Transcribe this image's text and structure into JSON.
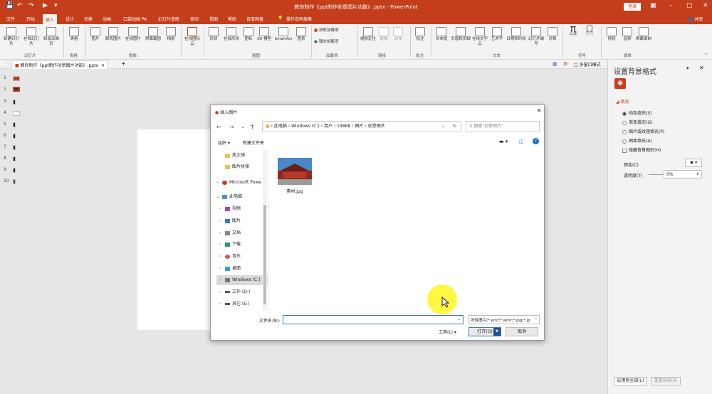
{
  "titlebar": {
    "title": "教你制作《ppt制作创意图片功能》.pptx - PowerPoint",
    "login": "登录",
    "share": "共享",
    "colors": {
      "brand": "#c43e1c"
    }
  },
  "quick_access": {
    "save_icon": "save-icon",
    "undo_icon": "undo-icon",
    "redo_icon": "redo-icon",
    "start_icon": "start-slideshow-icon",
    "more_icon": "more-icon"
  },
  "tabs": [
    "文件",
    "开始",
    "插入",
    "设计",
    "切换",
    "动画",
    "口袋动画 PA",
    "幻灯片放映",
    "审阅",
    "视图",
    "帮助",
    "百度网盘"
  ],
  "active_tab": "插入",
  "tell_me": "操作说明搜索",
  "ribbon": {
    "new_slide": "新建幻灯片",
    "online_slide": "在线幻灯片",
    "new_anim_page": "新加动画页",
    "group_slides": "幻灯片",
    "table": "表格",
    "group_table": "表格",
    "picture": "图片",
    "online_picture": "联机图片",
    "online_pic2": "在线图片",
    "screenshot": "屏幕截图",
    "album": "相册",
    "group_images": "图像",
    "online_icons": "在线图标云",
    "shapes": "形状",
    "online_shapes": "在线形状",
    "icons": "图标",
    "model3d": "3D 模型",
    "smartart": "SmartArt",
    "chart": "图表",
    "group_illus": "插图",
    "get_addins": "获取加载项",
    "my_addins": "我的加载项",
    "group_addins": "加载项",
    "zoom": "缩放定位",
    "link": "链接",
    "action": "动作",
    "group_links": "链接",
    "comment": "批注",
    "group_comments": "批注",
    "textbox": "文本框",
    "header_footer": "页眉和页脚",
    "online_text": "在线文字云",
    "wordart": "艺术字",
    "datetime": "日期和时间",
    "slide_no": "幻灯片编号",
    "object": "对象",
    "group_text": "文本",
    "equation": "公式",
    "symbol": "符号",
    "group_symbols": "符号",
    "video": "视频",
    "audio": "音频",
    "screen_rec": "屏幕录制",
    "group_media": "媒体"
  },
  "doc_tab": "教你制作《ppt制作创意图片功能》.pptx",
  "doc_right": "多窗口模式",
  "slides": [
    "1",
    "2",
    "3",
    "4",
    "5",
    "6",
    "7",
    "8",
    "9",
    "10"
  ],
  "pane": {
    "title": "设置背景格式",
    "section": "填充",
    "options": [
      "纯色填充(S)",
      "渐变填充(G)",
      "图片或纹理填充(P)",
      "图案填充(A)"
    ],
    "hide_bg": "隐藏背景图形(H)",
    "color_label": "颜色(C)",
    "transparency_label": "透明度(T)",
    "transparency_value": "0%",
    "apply_all": "应用到全部(L)",
    "reset_bg": "重置背景(B)"
  },
  "dialog": {
    "title": "插入图片",
    "breadcrumb": [
      "此电脑",
      "Windows (C:)",
      "用户",
      "19868",
      "图片",
      "创意图片"
    ],
    "search_placeholder": "搜索\"创意图片\"",
    "organize": "组织",
    "new_folder": "新建文件夹",
    "nav": [
      {
        "label": "放大镜",
        "level": 1
      },
      {
        "label": "图片拼接",
        "level": 1
      },
      {
        "label": "Microsoft Powe",
        "level": 0
      },
      {
        "label": "此电脑",
        "level": 0
      },
      {
        "label": "视频",
        "level": 1
      },
      {
        "label": "图片",
        "level": 1
      },
      {
        "label": "文档",
        "level": 1
      },
      {
        "label": "下载",
        "level": 1
      },
      {
        "label": "音乐",
        "level": 1
      },
      {
        "label": "桌面",
        "level": 1
      },
      {
        "label": "Windows (C:)",
        "level": 1
      },
      {
        "label": "工作 (D:)",
        "level": 1
      },
      {
        "label": "其它 (E:)",
        "level": 1
      }
    ],
    "file": {
      "name": "素材.jpg"
    },
    "filename_label": "文件名(N):",
    "filename_value": "",
    "filetype": "所有图片(*.emf;*.wmf;*.jpg;*.jp",
    "tools": "工具(L)",
    "open": "打开(O)",
    "cancel": "取消"
  }
}
